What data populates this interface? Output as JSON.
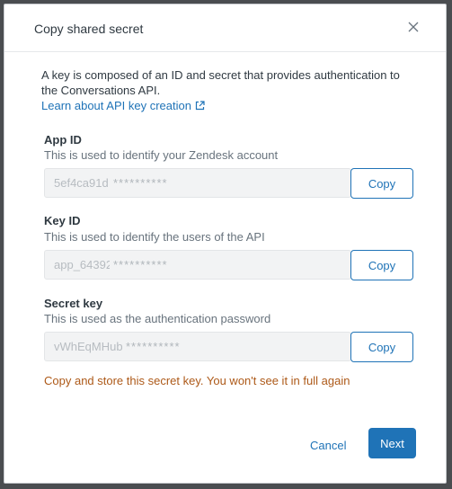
{
  "modal": {
    "title": "Copy shared secret",
    "intro": "A key is composed of an ID and secret that provides authentication to the Conversations API.",
    "learn_link": "Learn about API key creation"
  },
  "fields": [
    {
      "label": "App ID",
      "hint": "This is used to identify your Zendesk account",
      "value_prefix": "5ef4ca91d",
      "mask": "**********",
      "copy_label": "Copy"
    },
    {
      "label": "Key ID",
      "hint": "This is used to identify the users of the API",
      "value_prefix": "app_64392",
      "mask": "**********",
      "copy_label": "Copy"
    },
    {
      "label": "Secret key",
      "hint": "This is used as the authentication password",
      "value_prefix": "vWhEqMHub",
      "mask": "**********",
      "copy_label": "Copy"
    }
  ],
  "warning": "Copy and store this secret key. You won't see it in full again",
  "footer": {
    "cancel_label": "Cancel",
    "next_label": "Next"
  },
  "colors": {
    "link": "#1f73b7",
    "warning": "#ad5918",
    "primary": "#1f73b7"
  },
  "icons": {
    "close": "close-icon",
    "external": "external-link-icon"
  }
}
